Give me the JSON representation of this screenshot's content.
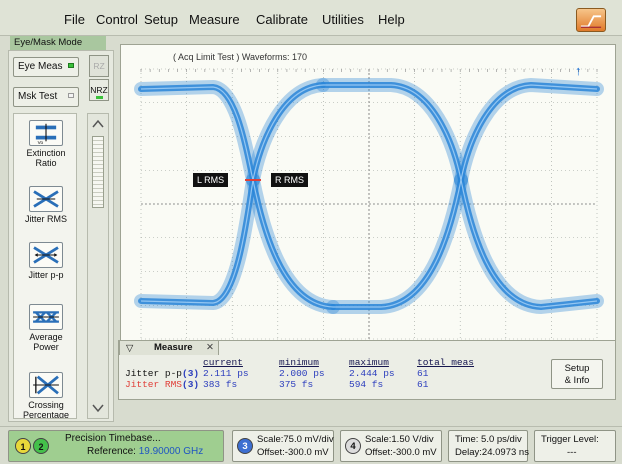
{
  "menu": {
    "file": "File",
    "control": "Control",
    "setup": "Setup",
    "measure": "Measure",
    "calibrate": "Calibrate",
    "utilities": "Utilities",
    "help": "Help"
  },
  "mode_label": "Eye/Mask Mode",
  "left_panel": {
    "eye_meas": "Eye Meas",
    "mask_test": "Msk Test",
    "rz": "RZ",
    "nrz": "NRZ",
    "measurements": [
      {
        "label_line1": "Extinction",
        "label_line2": "Ratio",
        "icon": "extinction-ratio-icon"
      },
      {
        "label_line1": "Jitter RMS",
        "label_line2": "",
        "icon": "jitter-rms-icon"
      },
      {
        "label_line1": "Jitter p-p",
        "label_line2": "",
        "icon": "jitter-pp-icon"
      },
      {
        "label_line1": "Average",
        "label_line2": "Power",
        "icon": "average-power-icon"
      },
      {
        "label_line1": "Crossing",
        "label_line2": "Percentage",
        "icon": "crossing-percentage-icon"
      }
    ]
  },
  "display": {
    "status": "( Acq Limit Test )  Waveforms: 170",
    "left_marker": "L RMS",
    "right_marker": "R RMS",
    "trace_color": "#2a86d8",
    "trigger_arrow": "↑"
  },
  "measure_panel": {
    "title": "Measure",
    "headers": {
      "current": "current",
      "minimum": "minimum",
      "maximum": "maximum",
      "total": "total meas"
    },
    "rows": [
      {
        "name": "Jitter p-p",
        "channel": "(3)",
        "current": "2.111 ps",
        "minimum": "2.000 ps",
        "maximum": "2.444 ps",
        "total": "61"
      },
      {
        "name": "Jitter RMS",
        "channel": "(3)",
        "current": "383 fs",
        "minimum": "375 fs",
        "maximum": "594 fs",
        "total": "61"
      }
    ],
    "setup_line1": "Setup",
    "setup_line2": "& Info"
  },
  "status_bar": {
    "ch1": "1",
    "ch2": "2",
    "timebase_label": "Precision Timebase...",
    "reference_prefix": "Reference: ",
    "reference_value": "19.90000 GHz",
    "ch3": "3",
    "ch3_scale": "Scale:75.0 mV/div",
    "ch3_offset": "Offset:-300.0 mV",
    "ch4": "4",
    "ch4_scale": "Scale:1.50 V/div",
    "ch4_offset": "Offset:-300.0 mV",
    "time": "Time: 5.0 ps/div",
    "delay": "Delay:24.0973 ns",
    "trigger_label": "Trigger Level:",
    "trigger_value": "---"
  }
}
